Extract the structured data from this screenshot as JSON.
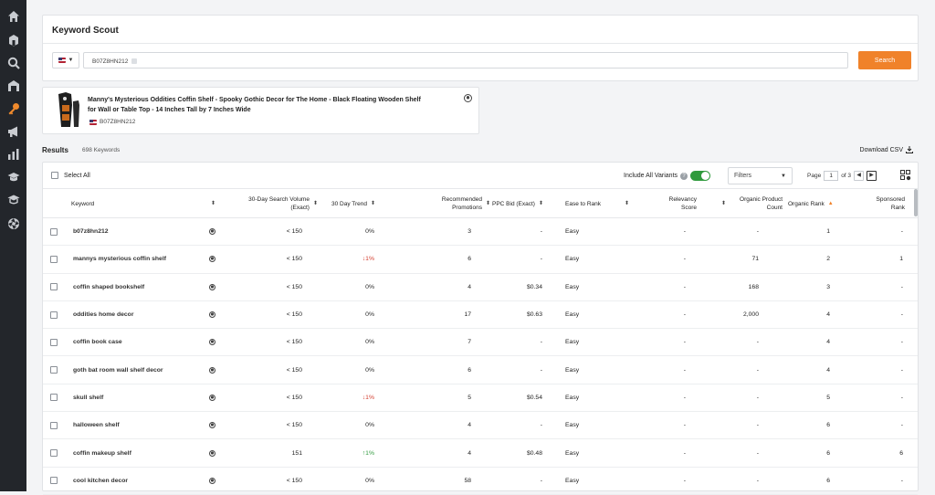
{
  "sidebar": {
    "items": [
      {
        "icon": "home-icon"
      },
      {
        "icon": "package-icon"
      },
      {
        "icon": "search-icon"
      },
      {
        "icon": "warehouse-icon"
      },
      {
        "icon": "key-icon",
        "active": true
      },
      {
        "icon": "megaphone-icon"
      },
      {
        "icon": "bar-chart-icon"
      },
      {
        "icon": "graduation-cap-icon"
      },
      {
        "icon": "academy-icon"
      },
      {
        "icon": "aperture-icon"
      }
    ]
  },
  "scout": {
    "title": "Keyword Scout",
    "country": "US",
    "chip": "B07Z8HN212",
    "search_label": "Search"
  },
  "product": {
    "title": "Manny's Mysterious Oddities Coffin Shelf - Spooky Gothic Decor for The Home - Black Floating Wooden Shelf for Wall or Table Top - 14 Inches Tall by 7 Inches Wide",
    "asin": "B07Z8HN212"
  },
  "results": {
    "label": "Results",
    "count": "698 Keywords",
    "download_label": "Download CSV"
  },
  "toolbar": {
    "select_all": "Select All",
    "include_variants": "Include All Variants",
    "filters": "Filters",
    "page_label": "Page",
    "page_value": "1",
    "page_of": "of 3"
  },
  "columns": {
    "keyword": "Keyword",
    "search_volume": "30-Day Search Volume (Exact)",
    "trend": "30 Day Trend",
    "promotions": "Recommended Promotions",
    "ppc": "PPC Bid (Exact)",
    "ease": "Ease to Rank",
    "relevancy": "Relevancy Score",
    "organic_count": "Organic Product Count",
    "organic_rank": "Organic Rank",
    "sponsored_rank": "Sponsored Rank"
  },
  "rows": [
    {
      "keyword": "b07z8hn212",
      "volume": "< 150",
      "trend": "0%",
      "trend_dir": "flat",
      "promotions": "3",
      "ppc": "-",
      "ease": "Easy",
      "relevancy": "-",
      "organic_count": "-",
      "organic_rank": "1",
      "sponsored_rank": "-"
    },
    {
      "keyword": "mannys mysterious coffin shelf",
      "volume": "< 150",
      "trend": "1%",
      "trend_dir": "down",
      "promotions": "6",
      "ppc": "-",
      "ease": "Easy",
      "relevancy": "-",
      "organic_count": "71",
      "organic_rank": "2",
      "sponsored_rank": "1"
    },
    {
      "keyword": "coffin shaped bookshelf",
      "volume": "< 150",
      "trend": "0%",
      "trend_dir": "flat",
      "promotions": "4",
      "ppc": "$0.34",
      "ease": "Easy",
      "relevancy": "-",
      "organic_count": "168",
      "organic_rank": "3",
      "sponsored_rank": "-"
    },
    {
      "keyword": "oddities home decor",
      "volume": "< 150",
      "trend": "0%",
      "trend_dir": "flat",
      "promotions": "17",
      "ppc": "$0.63",
      "ease": "Easy",
      "relevancy": "-",
      "organic_count": "2,000",
      "organic_rank": "4",
      "sponsored_rank": "-"
    },
    {
      "keyword": "coffin book case",
      "volume": "< 150",
      "trend": "0%",
      "trend_dir": "flat",
      "promotions": "7",
      "ppc": "-",
      "ease": "Easy",
      "relevancy": "-",
      "organic_count": "-",
      "organic_rank": "4",
      "sponsored_rank": "-"
    },
    {
      "keyword": "goth bat room wall shelf decor",
      "volume": "< 150",
      "trend": "0%",
      "trend_dir": "flat",
      "promotions": "6",
      "ppc": "-",
      "ease": "Easy",
      "relevancy": "-",
      "organic_count": "-",
      "organic_rank": "4",
      "sponsored_rank": "-"
    },
    {
      "keyword": "skull shelf",
      "volume": "< 150",
      "trend": "1%",
      "trend_dir": "down",
      "promotions": "5",
      "ppc": "$0.54",
      "ease": "Easy",
      "relevancy": "-",
      "organic_count": "-",
      "organic_rank": "5",
      "sponsored_rank": "-"
    },
    {
      "keyword": "halloween shelf",
      "volume": "< 150",
      "trend": "0%",
      "trend_dir": "flat",
      "promotions": "4",
      "ppc": "-",
      "ease": "Easy",
      "relevancy": "-",
      "organic_count": "-",
      "organic_rank": "6",
      "sponsored_rank": "-"
    },
    {
      "keyword": "coffin makeup shelf",
      "volume": "151",
      "trend": "1%",
      "trend_dir": "up",
      "promotions": "4",
      "ppc": "$0.48",
      "ease": "Easy",
      "relevancy": "-",
      "organic_count": "-",
      "organic_rank": "6",
      "sponsored_rank": "6"
    },
    {
      "keyword": "cool kitchen decor",
      "volume": "< 150",
      "trend": "0%",
      "trend_dir": "flat",
      "promotions": "58",
      "ppc": "-",
      "ease": "Easy",
      "relevancy": "-",
      "organic_count": "-",
      "organic_rank": "6",
      "sponsored_rank": "-"
    }
  ],
  "colors": {
    "accent": "#f0822a",
    "sidebar": "#23262b",
    "trend_down": "#d33b2c",
    "trend_up": "#2f9a3d"
  }
}
